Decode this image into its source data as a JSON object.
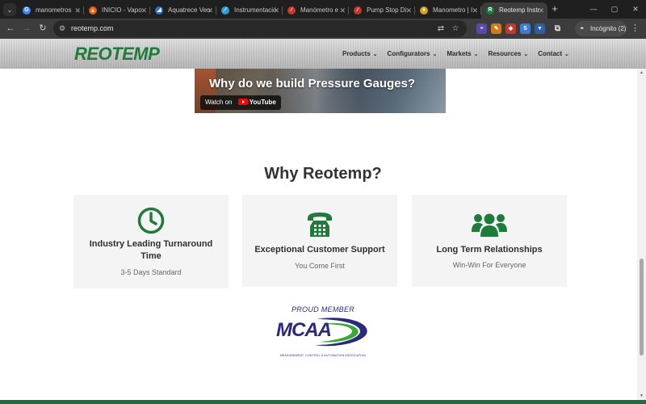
{
  "browser": {
    "tabs": [
      {
        "label": "manometros",
        "favicon": "google-icon",
        "color": "#4285f4",
        "glyph": "G"
      },
      {
        "label": "INICIO - Vapo",
        "favicon": "flame-icon",
        "color": "#e05a2a",
        "glyph": "🔥"
      },
      {
        "label": "Aquatrece Ven",
        "favicon": "aquatrece-icon",
        "color": "#2a6fd6",
        "glyph": "◢"
      },
      {
        "label": "Instrumentació",
        "favicon": "instrument-icon",
        "color": "#2a9fd6",
        "glyph": "⟋"
      },
      {
        "label": "Manómetro e",
        "favicon": "gauge-site-icon",
        "color": "#c0392b",
        "glyph": "∕"
      },
      {
        "label": "Pump Stop Di",
        "favicon": "pump-site-icon",
        "color": "#c0392b",
        "glyph": "∕"
      },
      {
        "label": "Manometro | I",
        "favicon": "gauge-shop-icon",
        "color": "#d4a017",
        "glyph": "●"
      },
      {
        "label": "Reotemp Instr",
        "favicon": "reotemp-icon",
        "color": "#1e7b3a",
        "glyph": "R",
        "active": true
      }
    ],
    "new_tab": "+",
    "url": "reotemp.com",
    "profile_label": "Incógnito (2)"
  },
  "site": {
    "logo_text": "REOTEMP",
    "nav": [
      "Products",
      "Configurators",
      "Markets",
      "Resources",
      "Contact"
    ]
  },
  "video": {
    "title": "Why do we build Pressure Gauges?",
    "watch_on": "Watch on",
    "platform": "YouTube"
  },
  "why": {
    "title": "Why Reotemp?",
    "cards": [
      {
        "icon": "clock-icon",
        "title": "Industry Leading Turnaround Time",
        "subtitle": "3-5 Days Standard"
      },
      {
        "icon": "telephone-icon",
        "title": "Exceptional Customer Support",
        "subtitle": "You Come First"
      },
      {
        "icon": "users-group-icon",
        "title": "Long Term Relationships",
        "subtitle": "Win-Win For Everyone"
      }
    ]
  },
  "mcaa": {
    "proud": "PROUD MEMBER",
    "mark": "MCAA",
    "subtitle": "MEASUREMENT, CONTROL & AUTOMATION ASSOCIATION"
  },
  "colors": {
    "brand_green": "#1e7b3a",
    "mcaa_navy": "#2b2a7a",
    "mcaa_green": "#3aa935",
    "card_bg": "#f4f4f4"
  }
}
